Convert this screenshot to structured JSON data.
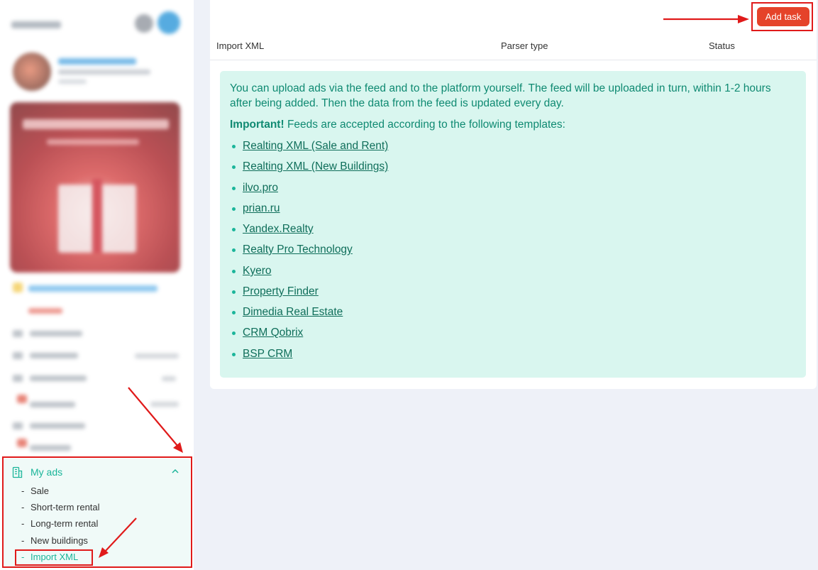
{
  "sidebar": {
    "my_ads": {
      "label": "My ads",
      "items": [
        {
          "label": "Sale"
        },
        {
          "label": "Short-term rental"
        },
        {
          "label": "Long-term rental"
        },
        {
          "label": "New buildings"
        },
        {
          "label": "Import XML"
        }
      ]
    }
  },
  "main": {
    "add_task_label": "Add task",
    "columns": [
      "Import XML",
      "Parser type",
      "Status"
    ],
    "info": {
      "text": "You can upload ads via the feed and to the platform yourself. The feed will be uploaded in turn, within 1-2 hours after being added. Then the data from the feed is updated every day.",
      "important_label": "Important!",
      "important_text": " Feeds are accepted according to the following templates:",
      "feeds": [
        "Realting XML (Sale and Rent)",
        "Realting XML (New Buildings)",
        "ilvo.pro",
        "prian.ru",
        "Yandex.Realty",
        "Realty Pro Technology",
        "Kyero",
        "Property Finder",
        "Dimedia Real Estate",
        "CRM Qobrix",
        "BSP CRM"
      ]
    }
  },
  "colors": {
    "accent": "#1bb59a",
    "button": "#e5432a",
    "info_bg": "#d9f6ef",
    "annotation": "#e01a1a"
  }
}
